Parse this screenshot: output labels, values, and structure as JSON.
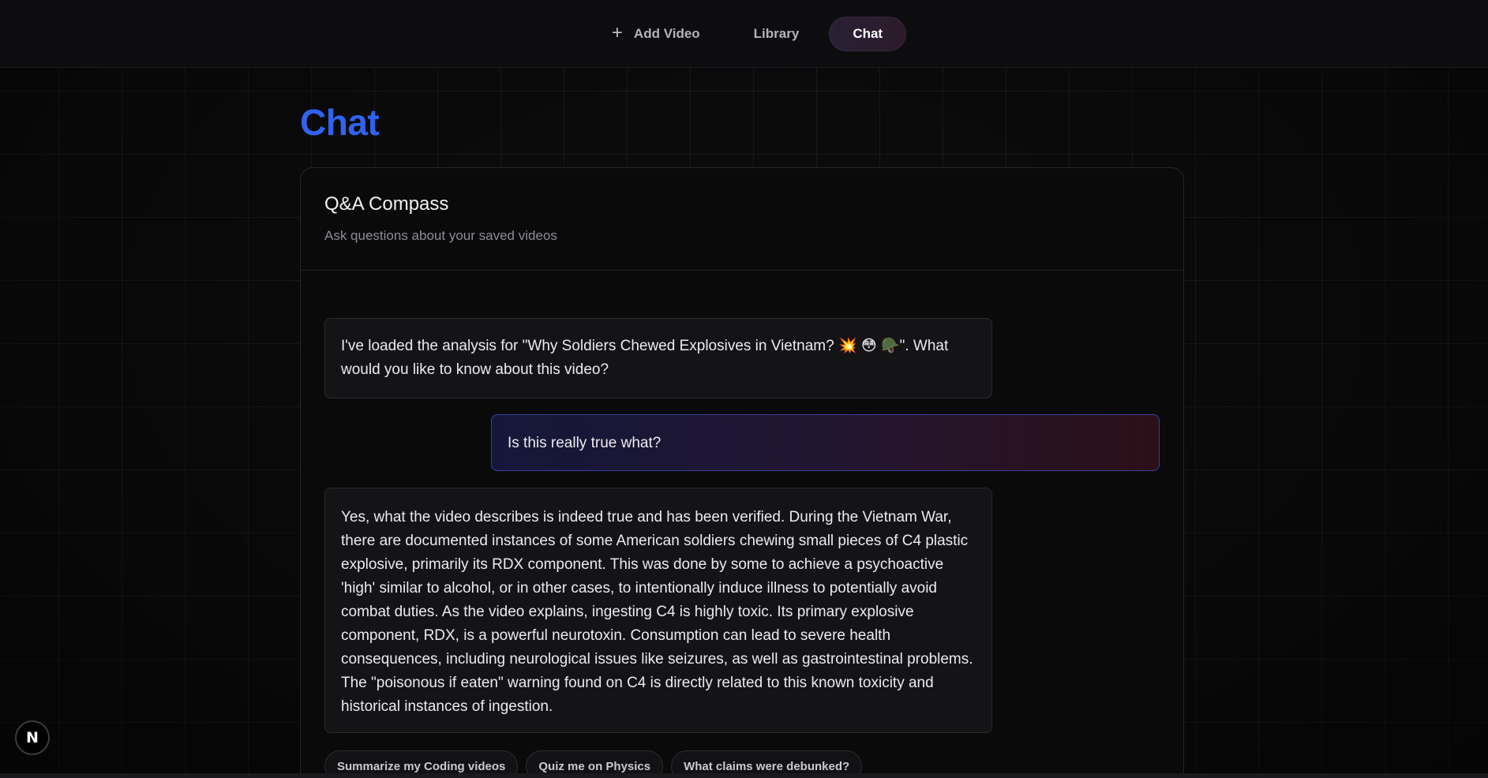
{
  "nav": {
    "items": [
      {
        "label": "Add Video",
        "icon": "plus-icon",
        "glyph": "+",
        "active": false
      },
      {
        "label": "Library",
        "active": false
      },
      {
        "label": "Chat",
        "active": true
      }
    ],
    "active_color": "#2a1f35"
  },
  "page": {
    "title": "Chat",
    "title_color": "#2f63f0"
  },
  "panel": {
    "title": "Q&A Compass",
    "subtitle": "Ask questions about your saved videos"
  },
  "messages": [
    {
      "role": "assistant",
      "text": "I've loaded the analysis for \"Why Soldiers Chewed Explosives in Vietnam? 💥 😳 🪖\". What would you like to know about this video?"
    },
    {
      "role": "user",
      "text": "Is this really true what?"
    },
    {
      "role": "assistant",
      "text": "Yes, what the video describes is indeed true and has been verified. During the Vietnam War, there are documented instances of some American soldiers chewing small pieces of C4 plastic explosive, primarily its RDX component. This was done by some to achieve a psychoactive 'high' similar to alcohol, or in other cases, to intentionally induce illness to potentially avoid combat duties. As the video explains, ingesting C4 is highly toxic. Its primary explosive component, RDX, is a powerful neurotoxin. Consumption can lead to severe health consequences, including neurological issues like seizures, as well as gastrointestinal problems. The \"poisonous if eaten\" warning found on C4 is directly related to this known toxicity and historical instances of ingestion."
    }
  ],
  "suggestions": [
    "Summarize my Coding videos",
    "Quiz me on Physics",
    "What claims were debunked?"
  ],
  "corner_logo": {
    "letter": "N",
    "icon": "n-logo-icon"
  }
}
